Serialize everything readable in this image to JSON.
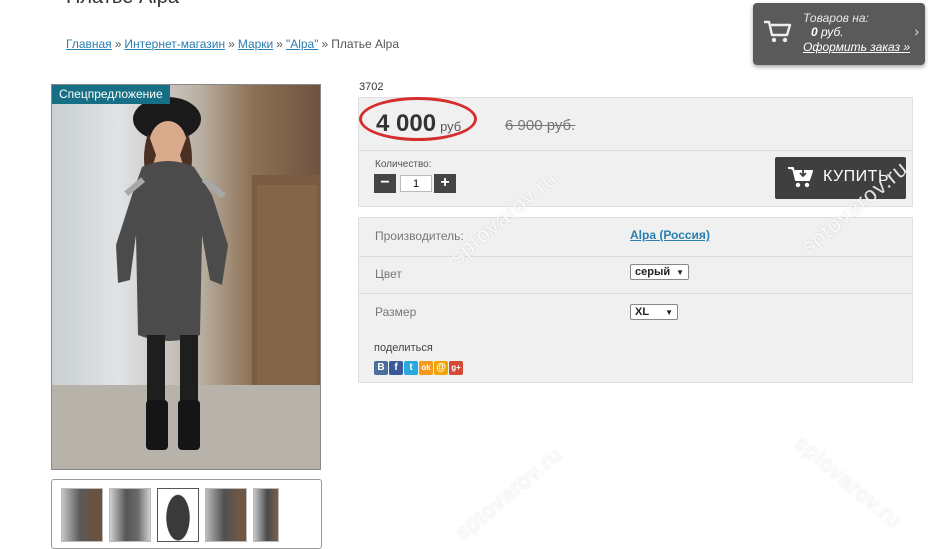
{
  "page": {
    "title": "Платье Alpa"
  },
  "breadcrumb": {
    "items": [
      "Главная",
      "Интернет-магазин",
      "Марки",
      "\"Alpa\""
    ],
    "current": "Платье Alpa",
    "separator": "»"
  },
  "cart": {
    "line1": "Товаров на:",
    "amount": "0",
    "currency": " руб.",
    "checkout": "Оформить заказ »",
    "chevron": "›"
  },
  "product": {
    "badge": "Спецпредложение",
    "sku": "3702",
    "price": "4 000",
    "price_currency": "руб",
    "old_price": "6 900 руб.",
    "quantity_label": "Количество:",
    "quantity": "1",
    "minus": "−",
    "plus": "+",
    "buy_label": "КУПИТЬ"
  },
  "attributes": {
    "manufacturer_label": "Производитель:",
    "manufacturer_value": "Alpa (Россия)",
    "color_label": "Цвет",
    "color_value": "серый",
    "size_label": "Размер",
    "size_value": "XL",
    "share_label": "поделиться",
    "share_icons": [
      "В",
      "f",
      "t",
      "ok",
      "@",
      "g+"
    ]
  },
  "watermark": "sptovarov.ru",
  "colors": {
    "accent_link": "#2a7fb0",
    "badge": "#176f85",
    "highlight_ring": "#d62d2d"
  }
}
